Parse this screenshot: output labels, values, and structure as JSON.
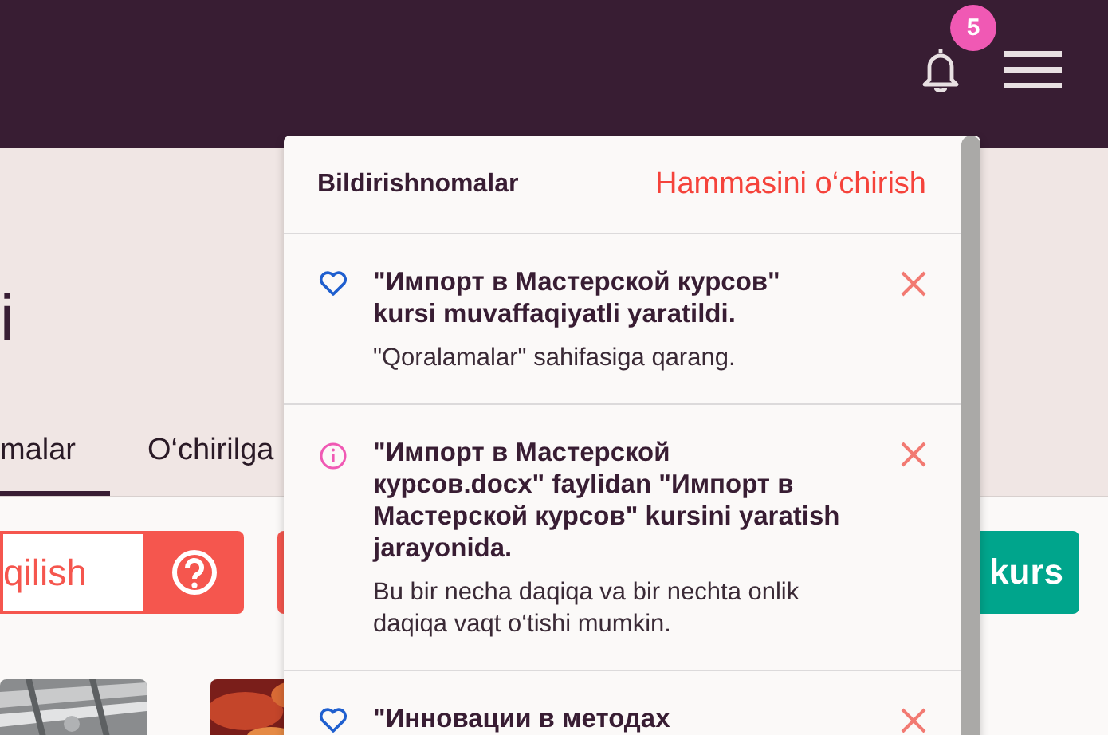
{
  "header": {
    "notification_count": "5"
  },
  "page": {
    "title": "i",
    "tabs": [
      {
        "label": "malar",
        "selected": true
      },
      {
        "label": "O‘chirilga",
        "selected": false
      }
    ],
    "actions": [
      {
        "kind": "outline",
        "label": "qilish"
      },
      {
        "kind": "danger"
      },
      {
        "kind": "primary",
        "label": "kurs"
      }
    ]
  },
  "notifications": {
    "title": "Bildirishnomalar",
    "clear_all": "Hammasini o‘chirish",
    "items": [
      {
        "kind": "success",
        "title": "\"Импорт в Мастерской курсов\" kursi muvaffaqiyatli yaratildi.",
        "body": "\"Qoralamalar\" sahifasiga qarang."
      },
      {
        "kind": "info",
        "title": "\"Импорт в Мастерской курсов.docx\" faylidan \"Импорт в Мастерской курсов\" kursini yaratish jarayonida.",
        "body": "Bu bir necha daqiqa va bir nechta onlik daqiqa vaqt o‘tishi mumkin."
      },
      {
        "kind": "success",
        "title": "\"Инновации в методах"
      }
    ]
  }
}
